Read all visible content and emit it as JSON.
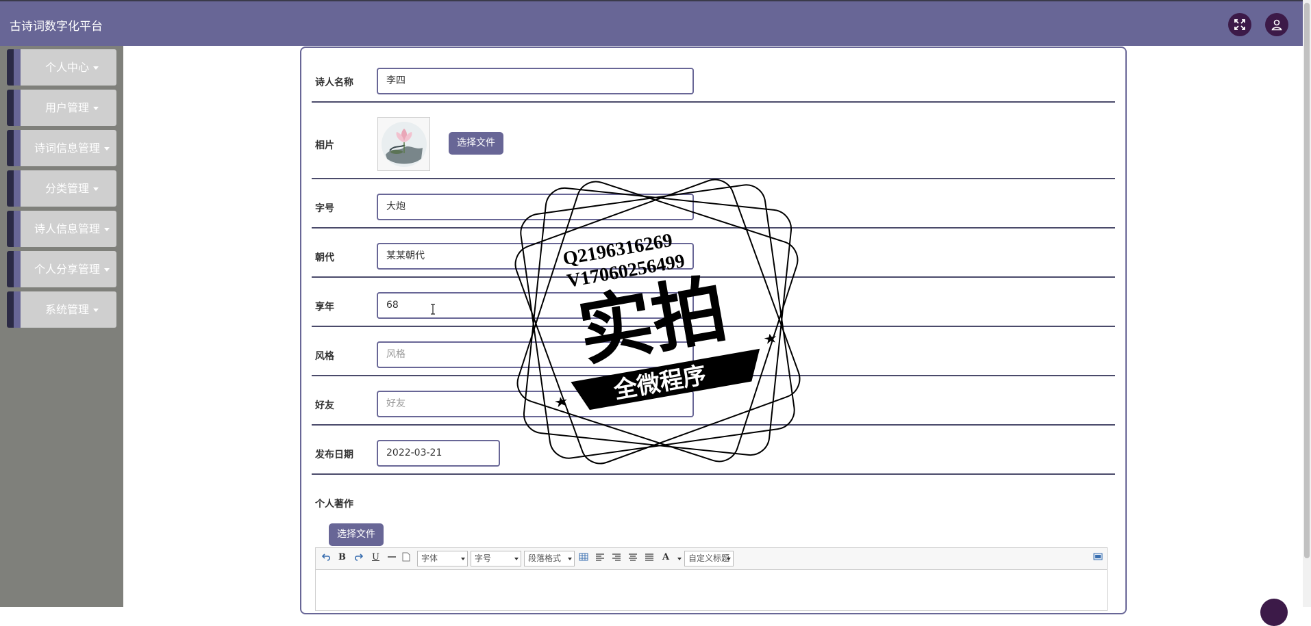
{
  "app": {
    "title": "古诗词数字化平台"
  },
  "sidebar": {
    "items": [
      {
        "label": "个人中心"
      },
      {
        "label": "用户管理"
      },
      {
        "label": "诗词信息管理"
      },
      {
        "label": "分类管理"
      },
      {
        "label": "诗人信息管理"
      },
      {
        "label": "个人分享管理"
      },
      {
        "label": "系统管理"
      }
    ]
  },
  "form": {
    "poet_name": {
      "label": "诗人名称",
      "value": "李四"
    },
    "photo": {
      "label": "相片",
      "button": "选择文件"
    },
    "courtesy_name": {
      "label": "字号",
      "value": "大炮"
    },
    "dynasty": {
      "label": "朝代",
      "value": "某某朝代"
    },
    "age": {
      "label": "享年",
      "value": "68"
    },
    "style": {
      "label": "风格",
      "placeholder": "风格"
    },
    "friends": {
      "label": "好友",
      "placeholder": "好友"
    },
    "publish_date": {
      "label": "发布日期",
      "value": "2022-03-21"
    },
    "works": {
      "label": "个人著作",
      "button": "选择文件"
    }
  },
  "editor": {
    "font_select": "字体",
    "size_select": "字号",
    "paragraph_select": "段落格式",
    "custom_title_select": "自定义标题",
    "bold": "B",
    "underline": "U",
    "font_color": "A"
  },
  "watermark": {
    "line1": "Q2196316269",
    "line2": "V17060256499",
    "main": "实拍",
    "banner": "全微程序"
  }
}
